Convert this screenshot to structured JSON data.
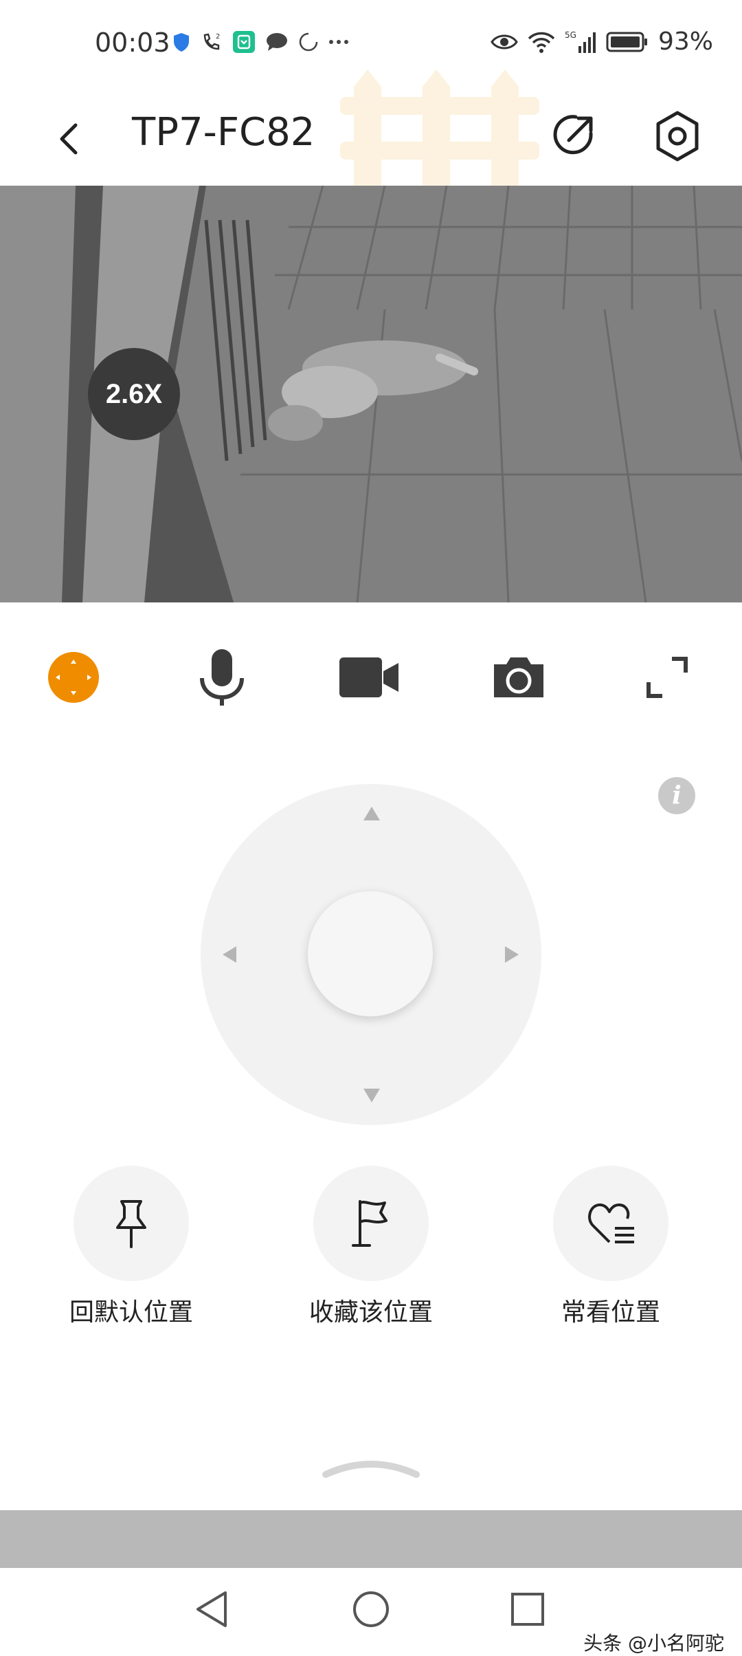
{
  "status_bar": {
    "time": "00:03",
    "battery_percent": "93%",
    "network": "5G",
    "icons": [
      "shield-icon",
      "wifi-call-icon",
      "mi-home-icon",
      "message-icon",
      "sync-icon",
      "more-icon",
      "eye-icon",
      "wifi-icon",
      "signal-icon",
      "battery-icon"
    ]
  },
  "header": {
    "title": "TP7-FC82",
    "icons": [
      "back-arrow-icon",
      "share-icon",
      "settings-icon"
    ]
  },
  "video": {
    "zoom": "2.6X"
  },
  "toolbar": {
    "items": [
      "ptz-icon",
      "microphone-icon",
      "record-video-icon",
      "snapshot-icon",
      "fullscreen-icon"
    ],
    "active_color": "#F08C00"
  },
  "ptz": {
    "info_label": "i"
  },
  "presets": [
    {
      "label": "回默认位置",
      "icon": "pin-icon"
    },
    {
      "label": "收藏该位置",
      "icon": "flag-icon"
    },
    {
      "label": "常看位置",
      "icon": "heart-list-icon"
    }
  ],
  "watermark": "头条 @小名阿驼"
}
